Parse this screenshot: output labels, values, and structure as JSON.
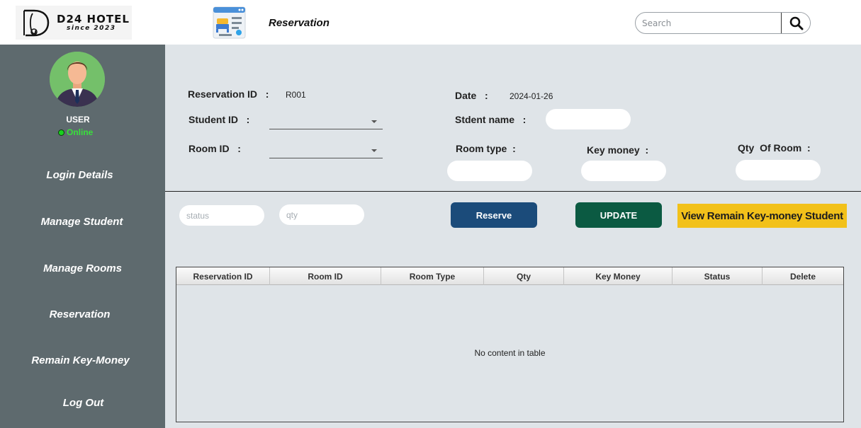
{
  "header": {
    "logo_name": "D24 HOTEL",
    "logo_since": "since 2023",
    "page_title": "Reservation",
    "search_placeholder": "Search"
  },
  "sidebar": {
    "user_label": "USER",
    "status_text": "Online",
    "items": [
      {
        "label": "Login Details"
      },
      {
        "label": "Manage Student"
      },
      {
        "label": "Manage Rooms"
      },
      {
        "label": "Reservation"
      },
      {
        "label": "Remain Key-Money"
      },
      {
        "label": "Log Out"
      }
    ]
  },
  "form": {
    "reservation_id_label": "Reservation ID   :",
    "reservation_id_value": "R001",
    "date_label": "Date   :",
    "date_value": "2024-01-26",
    "student_id_label": "Student ID   :",
    "student_name_label": "Stdent name   :",
    "room_id_label": "Room ID   :",
    "room_type_label": "Room type  :",
    "key_money_label": "Key money  :",
    "qty_of_room_label": "Qty  Of Room  :",
    "status_placeholder": "status",
    "qty_placeholder": "qty"
  },
  "actions": {
    "reserve_label": "Reserve",
    "update_label": "UPDATE",
    "view_remain_label": "View  Remain Key-money Student"
  },
  "table": {
    "columns": [
      "Reservation ID",
      "Room ID",
      "Room Type",
      "Qty",
      "Key Money",
      "Status",
      "Delete"
    ],
    "empty_message": "No content in table"
  },
  "colors": {
    "sidebar_bg": "#5e6a6e",
    "main_bg": "#dfe4e8",
    "reserve_btn": "#1b4b7a",
    "update_btn": "#0b5a42",
    "view_btn": "#f2c11a",
    "online": "#39e03c"
  },
  "icons": {
    "logo": "d24-hotel-logo",
    "page": "reservation-icon",
    "search": "search-icon",
    "avatar": "user-avatar",
    "combo": "chevron-down-icon"
  }
}
